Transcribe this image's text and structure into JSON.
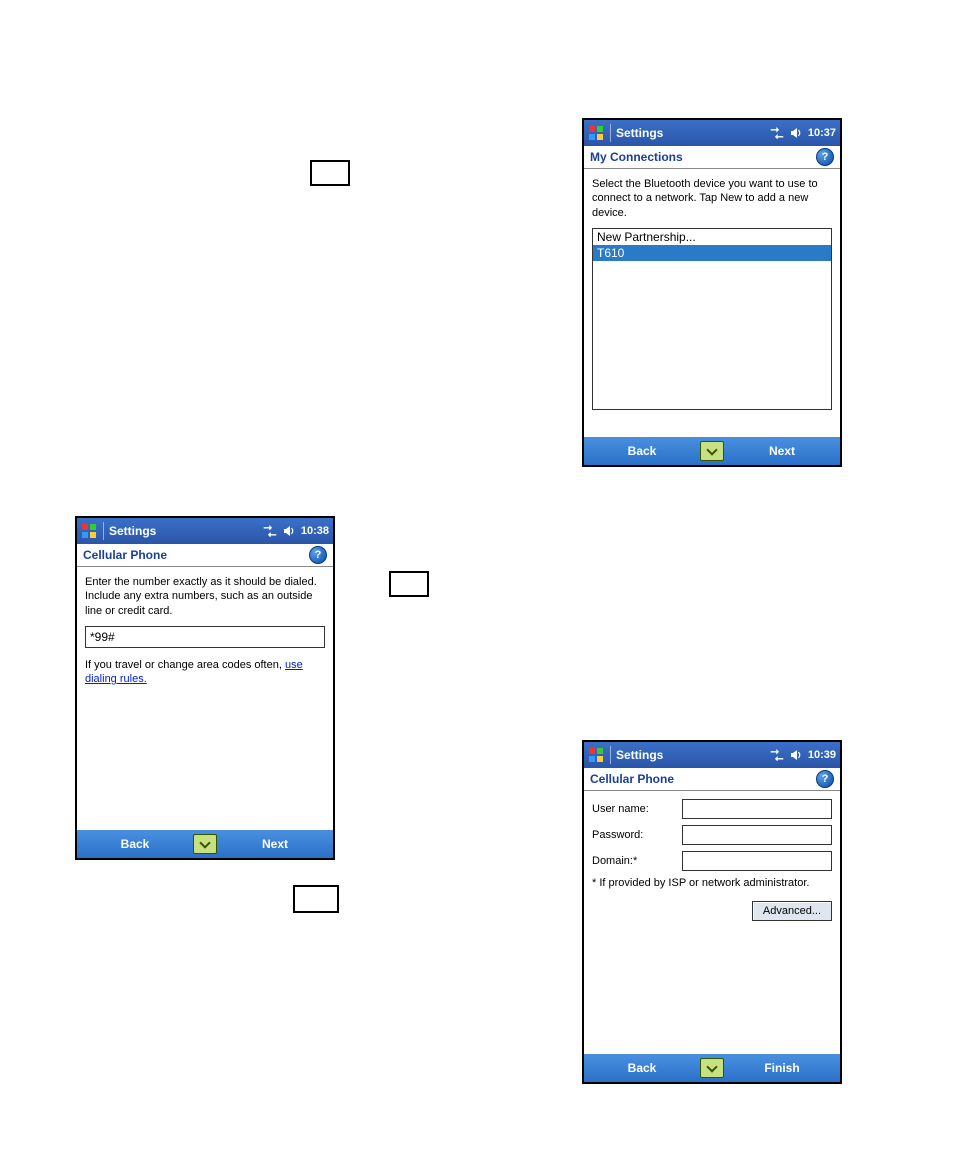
{
  "boxes": {
    "box1": {},
    "box2": {},
    "box3": {}
  },
  "pda1": {
    "titlebar": {
      "title": "Settings",
      "time": "10:37"
    },
    "subheader": "My Connections",
    "instructions": "Select the Bluetooth device you want to use to connect to a network. Tap New to add a new device.",
    "list": {
      "item0": "New Partnership...",
      "item1": "T610"
    },
    "back": "Back",
    "next": "Next"
  },
  "pda2": {
    "titlebar": {
      "title": "Settings",
      "time": "10:38"
    },
    "subheader": "Cellular Phone",
    "instructions": "Enter the number exactly as it should be dialed.  Include any extra numbers, such as an outside line or credit card.",
    "number": "*99#",
    "hint_prefix": "If you travel or change area codes often,",
    "hint_link": "use dialing rules.",
    "back": "Back",
    "next": "Next"
  },
  "pda3": {
    "titlebar": {
      "title": "Settings",
      "time": "10:39"
    },
    "subheader": "Cellular Phone",
    "labels": {
      "username": "User name:",
      "password": "Password:",
      "domain": "Domain:*"
    },
    "note": "* If provided by ISP or network administrator.",
    "advanced": "Advanced...",
    "back": "Back",
    "finish": "Finish"
  }
}
